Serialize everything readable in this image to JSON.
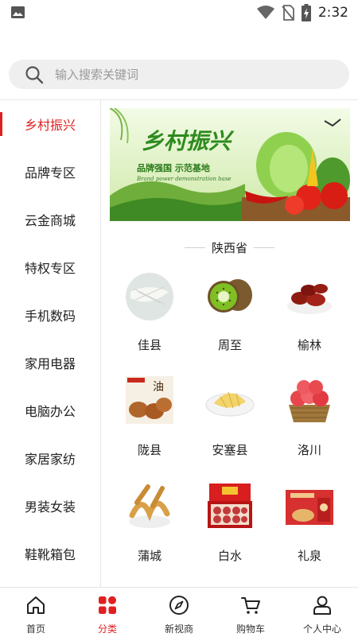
{
  "status_bar": {
    "time": "2:32",
    "left_icon": "image-icon",
    "right_icons": [
      "wifi-icon",
      "no-sim-icon",
      "battery-charging-icon"
    ]
  },
  "search": {
    "placeholder": "输入搜索关键词"
  },
  "sidebar": {
    "active_index": 0,
    "items": [
      {
        "label": "乡村振兴"
      },
      {
        "label": "品牌专区"
      },
      {
        "label": "云金商城"
      },
      {
        "label": "特权专区"
      },
      {
        "label": "手机数码"
      },
      {
        "label": "家用电器"
      },
      {
        "label": "电脑办公"
      },
      {
        "label": "家居家纺"
      },
      {
        "label": "男装女装"
      },
      {
        "label": "鞋靴箱包"
      }
    ]
  },
  "banner": {
    "title": "乡村振兴",
    "subtitle": "品牌强国 示范基地",
    "subtitle_en": "Brand power demonstration base"
  },
  "section": {
    "title": "陕西省"
  },
  "products": [
    {
      "name": "佳县",
      "icon": "vermicelli-image"
    },
    {
      "name": "周至",
      "icon": "kiwi-image"
    },
    {
      "name": "榆林",
      "icon": "red-dates-image"
    },
    {
      "name": "陇县",
      "icon": "oil-cakes-image"
    },
    {
      "name": "安塞县",
      "icon": "millet-cake-image"
    },
    {
      "name": "洛川",
      "icon": "apples-image"
    },
    {
      "name": "蒲城",
      "icon": "fried-dough-image"
    },
    {
      "name": "白水",
      "icon": "apple-gift-box-image"
    },
    {
      "name": "礼泉",
      "icon": "gift-box-image"
    }
  ],
  "tabbar": {
    "active_index": 1,
    "accent_color": "#e02020",
    "tabs": [
      {
        "label": "首页",
        "icon": "home-icon"
      },
      {
        "label": "分类",
        "icon": "category-icon"
      },
      {
        "label": "新视商",
        "icon": "compass-icon"
      },
      {
        "label": "购物车",
        "icon": "cart-icon"
      },
      {
        "label": "个人中心",
        "icon": "person-icon"
      }
    ]
  }
}
